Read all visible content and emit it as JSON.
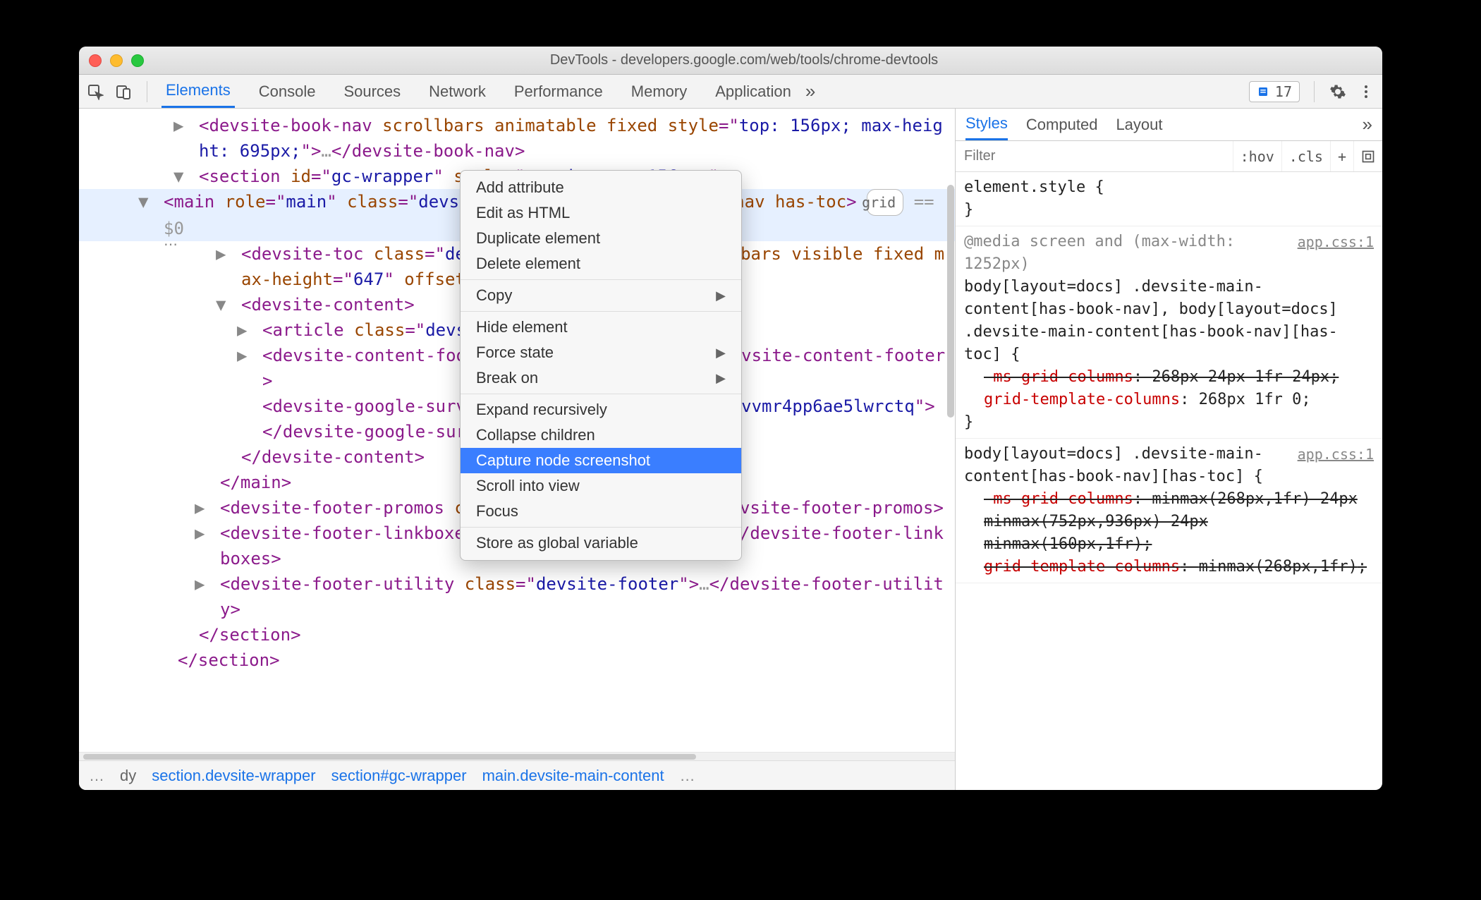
{
  "window": {
    "title": "DevTools - developers.google.com/web/tools/chrome-devtools"
  },
  "toolbar": {
    "tabs": [
      "Elements",
      "Console",
      "Sources",
      "Network",
      "Performance",
      "Memory",
      "Application"
    ],
    "active_tab": "Elements",
    "overflow_glyph": "»",
    "badge_count": "17"
  },
  "dom": {
    "lines": [
      {
        "indent": 0,
        "disc": "▶",
        "html": "<devsite-book-nav scrollbars animatable fixed style=\"top: 156px; max-height: 695px;\">…</devsite-book-nav>"
      },
      {
        "indent": 0,
        "disc": "▼",
        "html": "<section id=\"gc-wrapper\" style=\"margin-top: 156px;\">"
      },
      {
        "indent": 1,
        "disc": "▼",
        "sel": true,
        "html": "<main role=\"main\" class=\"devsite-main-content\" has-book-nav has-toc>",
        "pill": "grid",
        "eq": "== $0"
      },
      {
        "indent": 2,
        "disc": "▶",
        "html": "<devsite-toc class=\"devsite-nav\" depth=\"2\" scrollbars visible fixed max-height=\"647\" offset=\"156\">…</devsite-toc>"
      },
      {
        "indent": 2,
        "disc": "▼",
        "html": "<devsite-content>"
      },
      {
        "indent": 3,
        "disc": "▶",
        "html": "<article class=\"devsite-article\">…</article>"
      },
      {
        "indent": 3,
        "disc": "▶",
        "html": "<devsite-content-footer class=\"nocontent\">…</devsite-content-footer>"
      },
      {
        "indent": 3,
        "disc": "",
        "html": "<devsite-google-survey survey-id=\"9wgazcj5ifxusvvmr4pp6ae5lwrctq\"></devsite-google-survey>"
      },
      {
        "indent": 2,
        "disc": "",
        "html": "</devsite-content>"
      },
      {
        "indent": 1,
        "disc": "",
        "html": "</main>"
      },
      {
        "indent": 1,
        "disc": "▶",
        "html": "<devsite-footer-promos class=\"devsite-footer\">…</devsite-footer-promos>"
      },
      {
        "indent": 1,
        "disc": "▶",
        "html": "<devsite-footer-linkboxes class=\"devsite-footer\">…</devsite-footer-linkboxes>"
      },
      {
        "indent": 1,
        "disc": "▶",
        "html": "<devsite-footer-utility class=\"devsite-footer\">…</devsite-footer-utility>"
      },
      {
        "indent": 0,
        "disc": "",
        "html": "</section>"
      },
      {
        "indent": -1,
        "disc": "",
        "html": "</section>"
      }
    ]
  },
  "context_menu": {
    "groups": [
      [
        "Add attribute",
        "Edit as HTML",
        "Duplicate element",
        "Delete element"
      ],
      [
        {
          "label": "Copy",
          "sub": true
        }
      ],
      [
        "Hide element",
        {
          "label": "Force state",
          "sub": true
        },
        {
          "label": "Break on",
          "sub": true
        }
      ],
      [
        "Expand recursively",
        "Collapse children",
        {
          "label": "Capture node screenshot",
          "hl": true
        },
        "Scroll into view",
        "Focus"
      ],
      [
        "Store as global variable"
      ]
    ]
  },
  "breadcrumb": {
    "items": [
      "…",
      "dy",
      "section.devsite-wrapper",
      "section#gc-wrapper",
      "main.devsite-main-content",
      "…"
    ]
  },
  "styles": {
    "tabs": [
      "Styles",
      "Computed",
      "Layout"
    ],
    "active_tab": "Styles",
    "overflow_glyph": "»",
    "filter_placeholder": "Filter",
    "toolbar_buttons": [
      ":hov",
      ".cls",
      "+"
    ],
    "rules": [
      {
        "selector": "element.style",
        "open": "{",
        "close": "}"
      },
      {
        "media": "@media screen and (max-width: 1252px)",
        "selector": "body[layout=docs] .devsite-main-content[has-book-nav], body[layout=docs] .devsite-main-content[has-book-nav][has-toc]",
        "src": "app.css:1",
        "open": "{",
        "props": [
          {
            "name": "-ms-grid-columns",
            "value": "268px 24px 1fr 24px",
            "struck": true
          },
          {
            "name": "grid-template-columns",
            "value": "268px 1fr 0",
            "struck": false
          }
        ],
        "close": "}"
      },
      {
        "selector": "body[layout=docs] .devsite-main-content[has-book-nav][has-toc]",
        "src": "app.css:1",
        "open": "{",
        "props": [
          {
            "name": "-ms-grid-columns",
            "value": "minmax(268px,1fr) 24px minmax(752px,936px) 24px minmax(160px,1fr)",
            "struck": true
          },
          {
            "name": "grid-template-columns",
            "value": "minmax(268px,1fr)",
            "struck": true
          }
        ],
        "close": ""
      }
    ]
  }
}
